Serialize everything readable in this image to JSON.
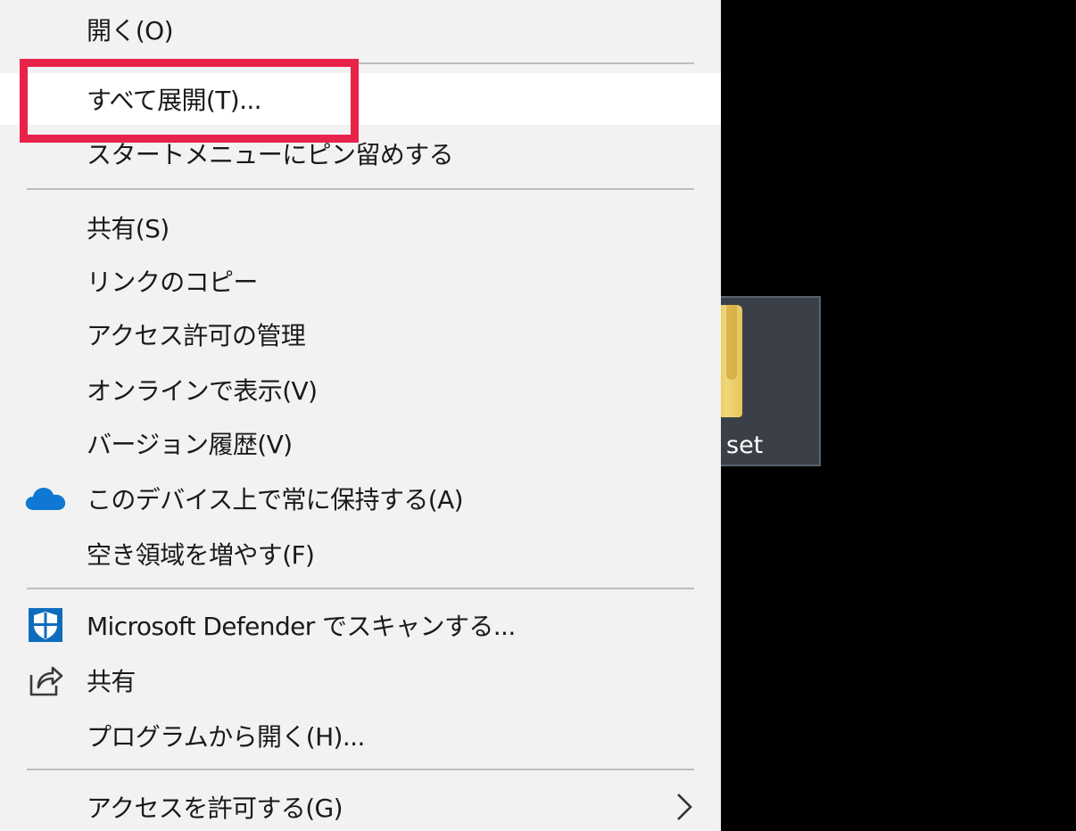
{
  "desktop": {
    "folder": {
      "label": "set"
    }
  },
  "context_menu": {
    "items": [
      {
        "label": "開く(O)"
      },
      {
        "label": "すべて展開(T)..."
      },
      {
        "label": "スタートメニューにピン留めする"
      },
      {
        "label": "共有(S)"
      },
      {
        "label": "リンクのコピー"
      },
      {
        "label": "アクセス許可の管理"
      },
      {
        "label": "オンラインで表示(V)"
      },
      {
        "label": "バージョン履歴(V)"
      },
      {
        "label": "このデバイス上で常に保持する(A)",
        "icon": "onedrive-cloud-icon"
      },
      {
        "label": "空き領域を増やす(F)"
      },
      {
        "label": "Microsoft Defender でスキャンする...",
        "icon": "defender-shield-icon"
      },
      {
        "label": "共有",
        "icon": "share-icon"
      },
      {
        "label": "プログラムから開く(H)..."
      },
      {
        "label": "アクセスを許可する(G)",
        "icon": "chevron-right-icon"
      }
    ],
    "highlighted_item": "すべて展開(T)..."
  },
  "colors": {
    "menu_background": "#f2f2f2",
    "highlight_background": "#ffffff",
    "annotation_border": "#e8234a",
    "onedrive_blue": "#0f78d4",
    "defender_blue": "#0f6cbd"
  }
}
